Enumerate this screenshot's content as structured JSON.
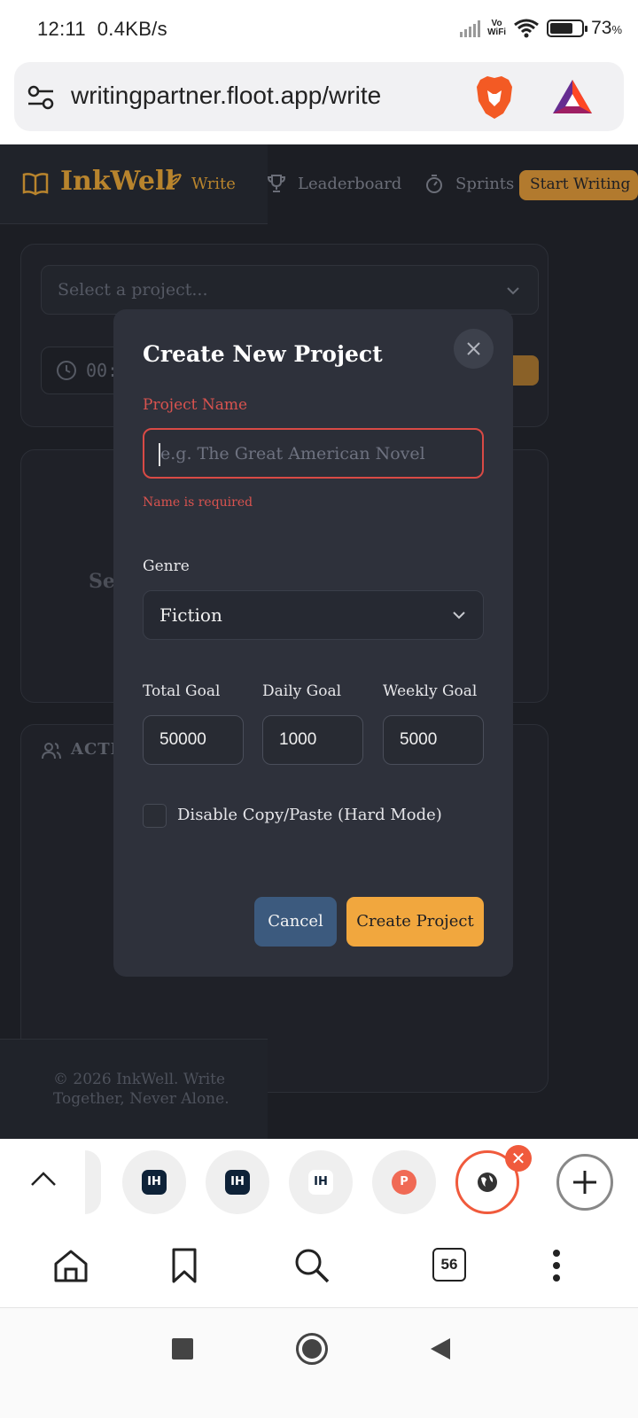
{
  "status_bar": {
    "time": "12:11",
    "net_speed": "0.4KB/s",
    "vowifi_top": "Vo",
    "vowifi_bottom": "WiFi",
    "battery_percent": "73",
    "battery_unit": "%",
    "battery_level": 0.73
  },
  "browser": {
    "url": "writingpartner.floot.app/write",
    "tab_count": "56"
  },
  "app": {
    "brand": "InkWell",
    "nav": {
      "write": "Write",
      "leaderboard": "Leaderboard",
      "sprints": "Sprints",
      "start_writing": "Start Writing"
    },
    "project_select_placeholder": "Select a project...",
    "timer_partial": "00:",
    "select_partial": "Sel",
    "activity_partial": "ACTIV",
    "footer": "© 2026 InkWell. Write Together, Never Alone."
  },
  "modal": {
    "title": "Create New Project",
    "project_name_label": "Project Name",
    "project_name_placeholder": "e.g. The Great American Novel",
    "project_name_error": "Name is required",
    "genre_label": "Genre",
    "genre_value": "Fiction",
    "total_goal_label": "Total Goal",
    "total_goal_value": "50000",
    "daily_goal_label": "Daily Goal",
    "daily_goal_value": "1000",
    "weekly_goal_label": "Weekly Goal",
    "weekly_goal_value": "5000",
    "hard_mode_label": "Disable Copy/Paste (Hard Mode)",
    "cancel": "Cancel",
    "create": "Create Project"
  },
  "tabs": [
    {
      "icon": "ih",
      "label": "IH"
    },
    {
      "icon": "ih",
      "label": "IH"
    },
    {
      "icon": "ih",
      "label": "IH"
    },
    {
      "icon": "p",
      "label": "P"
    },
    {
      "icon": "globe-icon"
    }
  ],
  "colors": {
    "accent": "#f1a73e",
    "error": "#d9534f",
    "cancel": "#3c5a7e",
    "modal_bg": "#2e313b",
    "page_bg": "#1c1e24"
  }
}
